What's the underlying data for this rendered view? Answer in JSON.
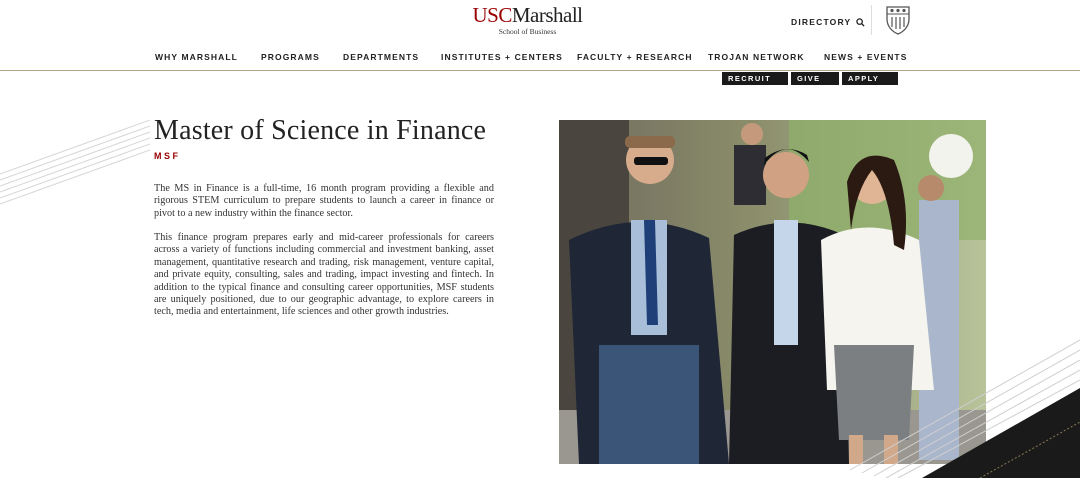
{
  "header": {
    "logo": {
      "usc": "USC",
      "marshall": "Marshall",
      "subtitle": "School of Business"
    },
    "directory_label": "DIRECTORY",
    "search_icon": "search-icon",
    "shield_icon": "usc-shield-icon"
  },
  "nav": {
    "items": [
      {
        "label": "WHY MARSHALL"
      },
      {
        "label": "PROGRAMS"
      },
      {
        "label": "DEPARTMENTS"
      },
      {
        "label": "INSTITUTES + CENTERS"
      },
      {
        "label": "FACULTY + RESEARCH"
      },
      {
        "label": "TROJAN NETWORK"
      },
      {
        "label": "NEWS + EVENTS"
      }
    ]
  },
  "utility": {
    "recruit": "RECRUIT",
    "give": "GIVE",
    "apply": "APPLY"
  },
  "main": {
    "title": "Master of Science in Finance",
    "subtitle": "MSF",
    "paragraph1": "The MS in Finance is a full-time, 16 month program providing a flexible and rigorous STEM curriculum to prepare students to launch a career in finance or pivot to a new industry within the finance sector.",
    "paragraph2": "This finance program prepares early and mid-career professionals for careers across a variety of functions including commercial and investment banking, asset management, quantitative research and trading, risk management, venture capital, and private equity, consulting, sales and trading, impact investing and fintech. In addition to the typical finance and consulting career opportunities, MSF students are uniquely positioned, due to our geographic advantage, to explore careers in tech, media and entertainment, life sciences and other growth industries."
  },
  "colors": {
    "usc_cardinal": "#990000",
    "gold_rule": "#b4a58a",
    "dark": "#1a1a1a"
  }
}
